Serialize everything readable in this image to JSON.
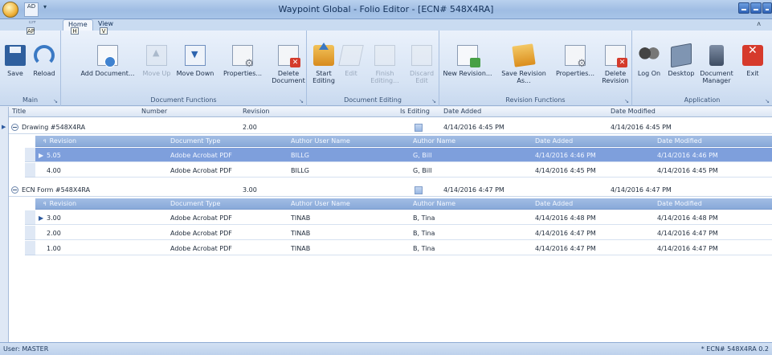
{
  "window": {
    "title": "Waypoint Global - Folio Editor - [ECN# 548X4RA]",
    "qat_keytip": "AD",
    "qat_icon_label": "AD"
  },
  "tabs": {
    "mini_label": "AP",
    "home": "Home",
    "home_keytip": "H",
    "view": "View",
    "view_keytip": "V",
    "ribbon_min": "ʌ"
  },
  "ribbon": {
    "groups": {
      "main": "Main",
      "document_functions": "Document Functions",
      "document_editing": "Document Editing",
      "revision_functions": "Revision Functions",
      "application": "Application"
    },
    "launcher": "↘",
    "buttons": {
      "save": "Save",
      "reload": "Reload",
      "add_document": "Add Document...",
      "move_up": "Move Up",
      "move_down": "Move Down",
      "properties": "Properties...",
      "delete_document_1": "Delete",
      "delete_document_2": "Document",
      "start_editing_1": "Start",
      "start_editing_2": "Editing",
      "edit_1": "Edit",
      "edit_2": "Edit",
      "finish_editing_1": "Finish",
      "finish_editing_2": "Editing...",
      "discard_edit_1": "Discard",
      "discard_edit_2": "Edit",
      "new_revision": "New Revision...",
      "save_revision_as_1": "Save Revision",
      "save_revision_as_2": "As...",
      "rev_properties": "Properties...",
      "delete_revision_1": "Delete",
      "delete_revision_2": "Revision",
      "log_on": "Log On",
      "desktop": "Desktop",
      "document_manager_1": "Document",
      "document_manager_2": "Manager",
      "exit": "Exit"
    }
  },
  "grid": {
    "columns": [
      "Title",
      "Number",
      "Revision",
      "Is Editing",
      "Date Added",
      "Date Modified"
    ],
    "child_columns": [
      "Revision",
      "Document Type",
      "Author User Name",
      "Author Name",
      "Date Added",
      "Date Modified"
    ],
    "documents": [
      {
        "title": "Drawing #548X4RA",
        "number": "",
        "revision": "2.00",
        "date_added": "4/14/2016 4:45 PM",
        "date_modified": "4/14/2016 4:45 PM",
        "revisions": [
          {
            "revision": "5.05",
            "doc_type": "Adobe Acrobat PDF",
            "author_user": "BILLG",
            "author_name": "G, Bill",
            "date_added": "4/14/2016 4:46 PM",
            "date_modified": "4/14/2016 4:46 PM"
          },
          {
            "revision": "4.00",
            "doc_type": "Adobe Acrobat PDF",
            "author_user": "BILLG",
            "author_name": "G, Bill",
            "date_added": "4/14/2016 4:45 PM",
            "date_modified": "4/14/2016 4:45 PM"
          }
        ]
      },
      {
        "title": "ECN Form #548X4RA",
        "number": "",
        "revision": "3.00",
        "date_added": "4/14/2016 4:47 PM",
        "date_modified": "4/14/2016 4:47 PM",
        "revisions": [
          {
            "revision": "3.00",
            "doc_type": "Adobe Acrobat PDF",
            "author_user": "TINAB",
            "author_name": "B, Tina",
            "date_added": "4/14/2016 4:48 PM",
            "date_modified": "4/14/2016 4:48 PM"
          },
          {
            "revision": "2.00",
            "doc_type": "Adobe Acrobat PDF",
            "author_user": "TINAB",
            "author_name": "B, Tina",
            "date_added": "4/14/2016 4:47 PM",
            "date_modified": "4/14/2016 4:47 PM"
          },
          {
            "revision": "1.00",
            "doc_type": "Adobe Acrobat PDF",
            "author_user": "TINAB",
            "author_name": "B, Tina",
            "date_added": "4/14/2016 4:47 PM",
            "date_modified": "4/14/2016 4:47 PM"
          }
        ]
      }
    ]
  },
  "status": {
    "user": "User: MASTER",
    "right": "* ECN# 548X4RA  0.2"
  },
  "icons": {
    "save": "save-icon",
    "reload": "reload-icon",
    "add_document": "add-document-icon",
    "move_up": "move-up-icon",
    "move_down": "move-down-icon",
    "properties": "properties-icon",
    "delete": "delete-icon",
    "start_editing": "start-editing-icon",
    "exit": "exit-icon"
  },
  "colors": {
    "selected_row": "#7e9fdc",
    "child_header": "#93b2df",
    "title_bar": "#a7c4e8"
  }
}
